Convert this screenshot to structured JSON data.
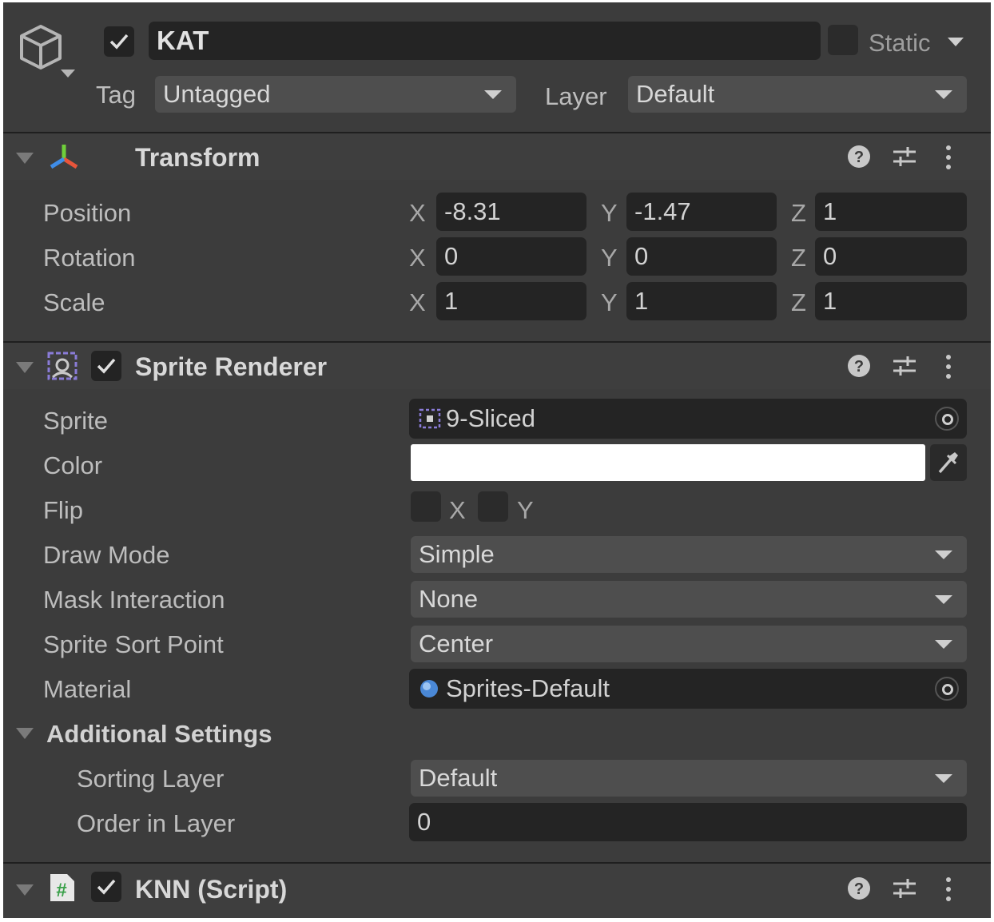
{
  "header": {
    "active": true,
    "name": "KAT",
    "static_label": "Static",
    "tag_label": "Tag",
    "tag_value": "Untagged",
    "layer_label": "Layer",
    "layer_value": "Default"
  },
  "transform": {
    "title": "Transform",
    "rows": [
      {
        "label": "Position",
        "x": "-8.31",
        "y": "-1.47",
        "z": "1"
      },
      {
        "label": "Rotation",
        "x": "0",
        "y": "0",
        "z": "0"
      },
      {
        "label": "Scale",
        "x": "1",
        "y": "1",
        "z": "1"
      }
    ],
    "axis": {
      "x": "X",
      "y": "Y",
      "z": "Z"
    }
  },
  "sprite_renderer": {
    "title": "Sprite Renderer",
    "enabled": true,
    "sprite_label": "Sprite",
    "sprite_value": "9-Sliced",
    "color_label": "Color",
    "color_value": "#ffffff",
    "flip_label": "Flip",
    "flip_x": "X",
    "flip_y": "Y",
    "draw_mode_label": "Draw Mode",
    "draw_mode_value": "Simple",
    "mask_label": "Mask Interaction",
    "mask_value": "None",
    "sort_point_label": "Sprite Sort Point",
    "sort_point_value": "Center",
    "material_label": "Material",
    "material_value": "Sprites-Default",
    "additional_label": "Additional Settings",
    "sorting_layer_label": "Sorting Layer",
    "sorting_layer_value": "Default",
    "order_label": "Order in Layer",
    "order_value": "0"
  },
  "knn_script": {
    "title": "KNN (Script)",
    "enabled": true
  },
  "icons": {
    "gameobject": "cube-icon",
    "transform": "transform-axes-icon",
    "sprite_renderer": "sprite-renderer-icon",
    "script": "csharp-script-icon",
    "help": "help-icon",
    "presets": "presets-icon",
    "menu": "kebab-menu-icon",
    "object_picker": "object-picker-icon",
    "eyedropper": "eyedropper-icon"
  }
}
